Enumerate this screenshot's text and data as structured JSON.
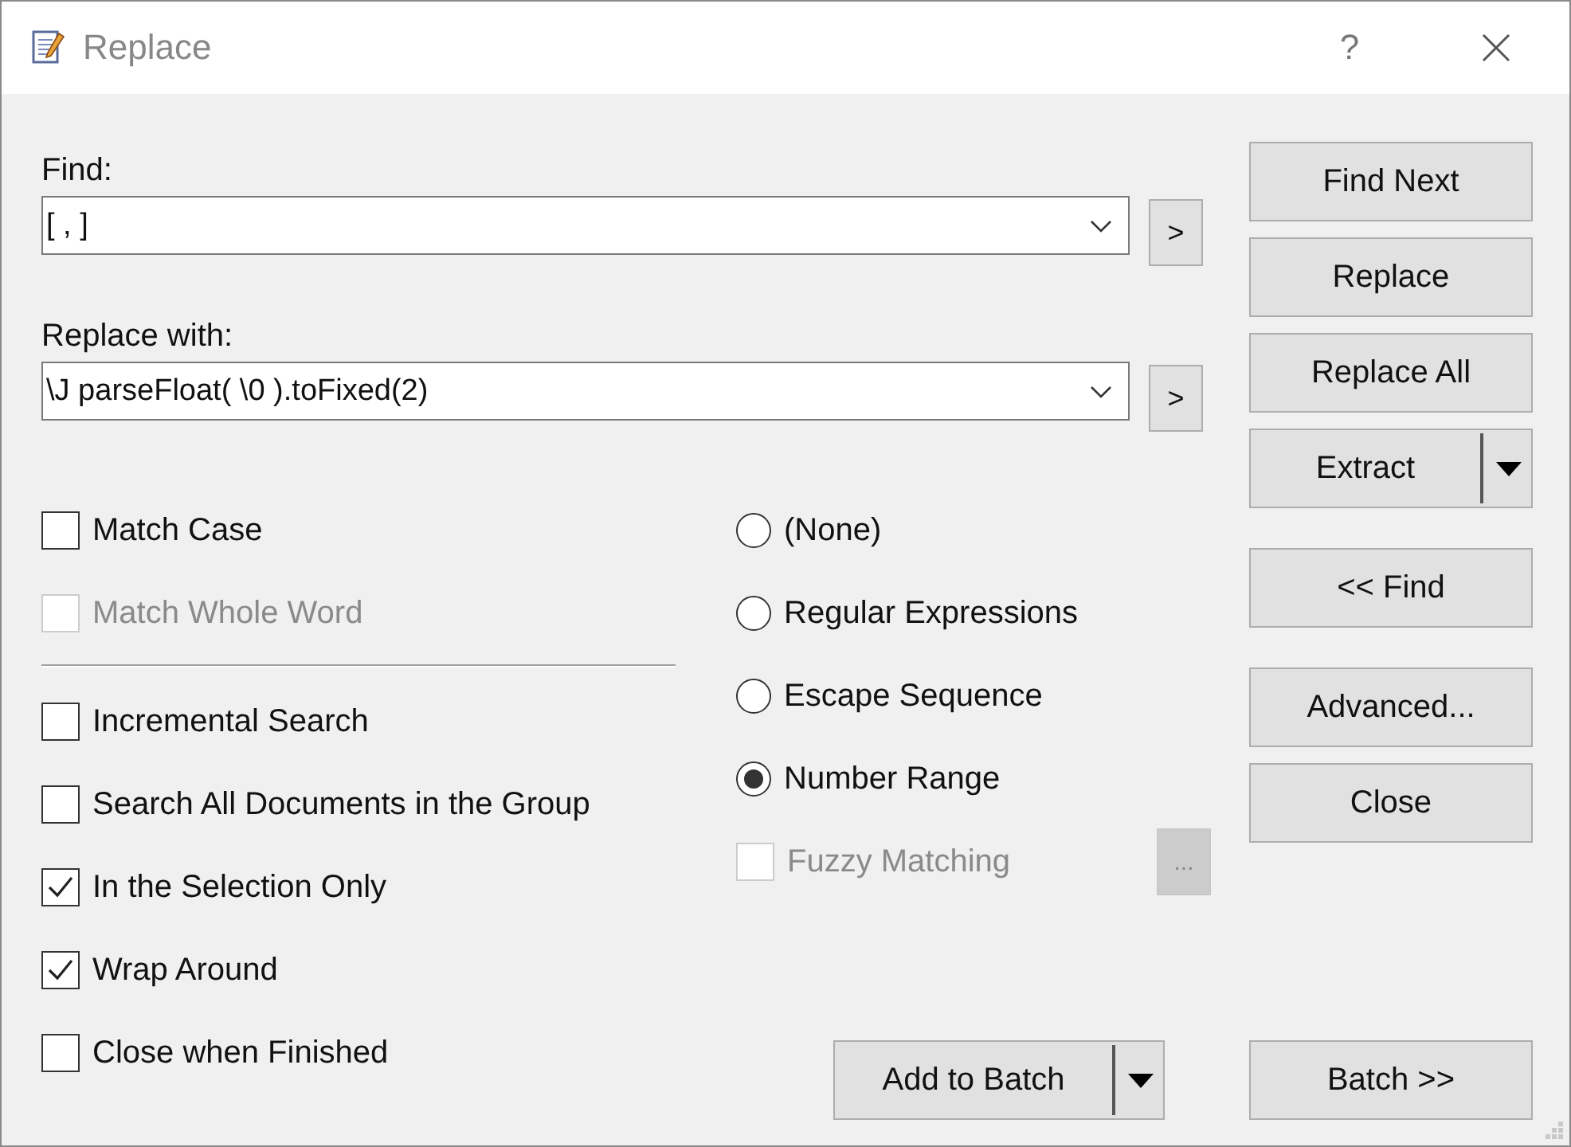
{
  "window": {
    "title": "Replace",
    "help_button": "?"
  },
  "find": {
    "label": "Find:",
    "value": "[ , ]",
    "history_button": ">"
  },
  "replace": {
    "label": "Replace with:",
    "value": "\\J parseFloat( \\0 ).toFixed(2)",
    "history_button": ">"
  },
  "options_top": [
    {
      "label": "Match Case",
      "checked": false,
      "disabled": false
    },
    {
      "label": "Match Whole Word",
      "checked": false,
      "disabled": true
    }
  ],
  "options_bottom": [
    {
      "label": "Incremental Search",
      "checked": false,
      "disabled": false
    },
    {
      "label": "Search All Documents in the Group",
      "checked": false,
      "disabled": false
    },
    {
      "label": "In the Selection Only",
      "checked": true,
      "disabled": false
    },
    {
      "label": "Wrap Around",
      "checked": true,
      "disabled": false
    },
    {
      "label": "Close when Finished",
      "checked": false,
      "disabled": false
    }
  ],
  "search_modes": [
    {
      "label": "(None)",
      "selected": false
    },
    {
      "label": "Regular Expressions",
      "selected": false
    },
    {
      "label": "Escape Sequence",
      "selected": false
    },
    {
      "label": "Number Range",
      "selected": true
    }
  ],
  "fuzzy": {
    "label": "Fuzzy Matching",
    "checked": false,
    "disabled": true,
    "button": "..."
  },
  "button_groups": [
    [
      {
        "label": "Find Next",
        "split": false
      },
      {
        "label": "Replace",
        "split": false
      },
      {
        "label": "Replace All",
        "split": false
      },
      {
        "label": "Extract",
        "split": true
      }
    ],
    [
      {
        "label": "<< Find",
        "split": false
      }
    ],
    [
      {
        "label": "Advanced...",
        "split": false
      },
      {
        "label": "Close",
        "split": false
      }
    ]
  ],
  "add_to_batch": {
    "label": "Add to Batch",
    "split": true
  },
  "batch": {
    "label": "Batch >>",
    "split": false
  }
}
